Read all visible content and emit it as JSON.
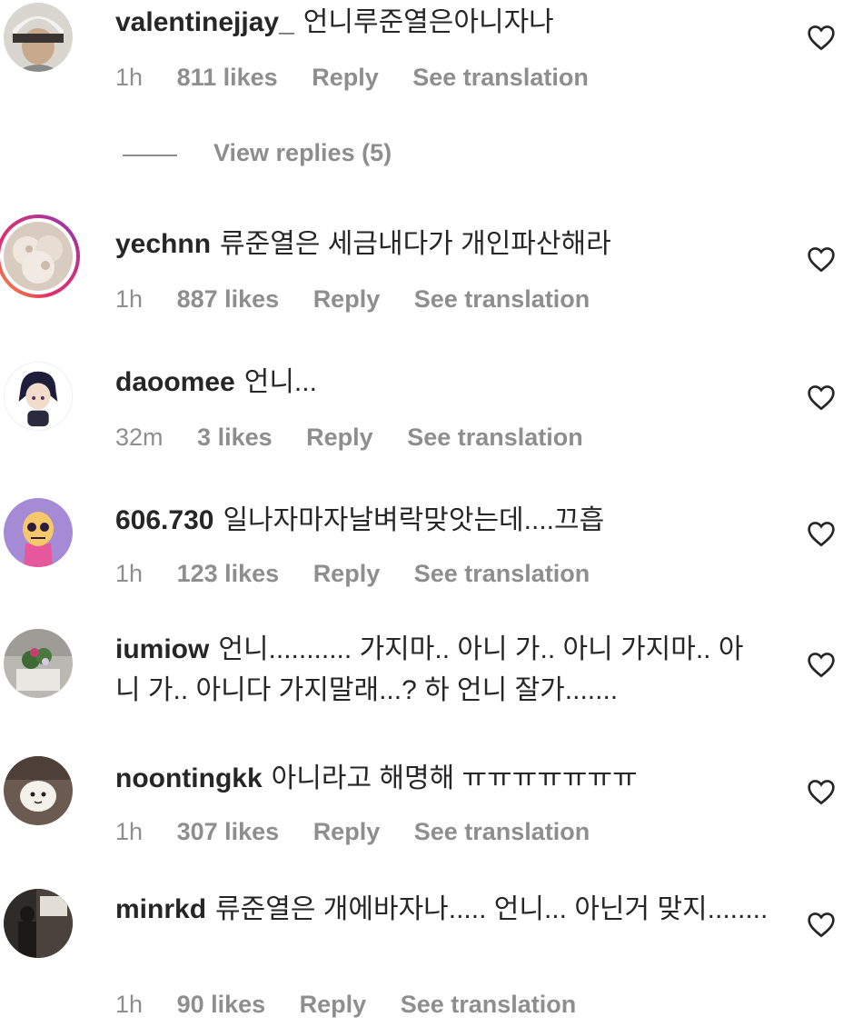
{
  "comments": [
    {
      "username": "valentinejjay_",
      "text": "언니루준열은아니자나",
      "time": "1h",
      "likes": "811 likes",
      "reply": "Reply",
      "translate": "See translation",
      "avatar": "avatar-photo"
    },
    {
      "username": "yechnn",
      "text": "류준열은 세금내다가 개인파산해라",
      "time": "1h",
      "likes": "887 likes",
      "reply": "Reply",
      "translate": "See translation",
      "avatar": "avatar-photo-story-ring"
    },
    {
      "username": "daoomee",
      "text": "언니...",
      "time": "32m",
      "likes": "3 likes",
      "reply": "Reply",
      "translate": "See translation",
      "avatar": "avatar-anime"
    },
    {
      "username": "606.730",
      "text": "일나자마자날벼락맞앗는데....끄흡",
      "time": "1h",
      "likes": "123 likes",
      "reply": "Reply",
      "translate": "See translation",
      "avatar": "avatar-cartoon"
    },
    {
      "username": "iumiow",
      "text": "언니........... 가지마.. 아니 가.. 아니 가지마.. 아니 가.. 아니다 가지말래...? 하 언니 잘가.......",
      "time": "",
      "likes": "",
      "reply": "",
      "translate": "",
      "avatar": "avatar-flowers"
    },
    {
      "username": "noontingkk",
      "text": "아니라고 해명해 ㅠㅠㅠㅠㅠㅠㅠ",
      "time": "1h",
      "likes": "307 likes",
      "reply": "Reply",
      "translate": "See translation",
      "avatar": "avatar-character"
    },
    {
      "username": "minrkd",
      "text": "류준열은 개에바자나..... 언니... 아닌거 맞지........",
      "time": "1h",
      "likes": "90 likes",
      "reply": "Reply",
      "translate": "See translation",
      "avatar": "avatar-cafe"
    }
  ],
  "view_replies": "View replies (5)",
  "icons": {
    "like": "heart-icon"
  },
  "colors": {
    "text": "#262626",
    "meta": "#8e8e8e",
    "ring_start": "#f9a829",
    "ring_end": "#833ab4"
  }
}
